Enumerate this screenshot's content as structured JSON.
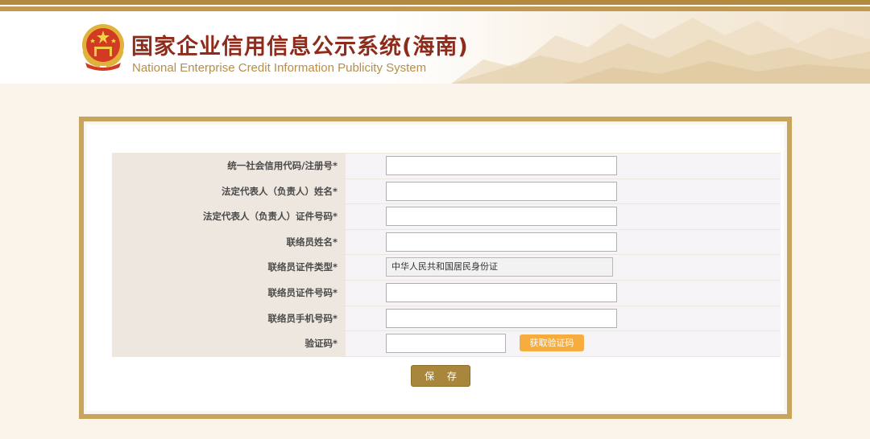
{
  "header": {
    "title_cn": "国家企业信用信息公示系统(海南)",
    "title_en": "National Enterprise Credit Information Publicity System",
    "emblem_icon": "national-emblem-icon"
  },
  "colors": {
    "accent_gold": "#c8a55c",
    "title_red": "#8e2b1b",
    "button_orange": "#f6ac3e",
    "button_brown": "#a8873d"
  },
  "form": {
    "fields": [
      {
        "label": "统一社会信用代码/注册号*",
        "value": ""
      },
      {
        "label": "法定代表人（负责人）姓名*",
        "value": ""
      },
      {
        "label": "法定代表人（负责人）证件号码*",
        "value": ""
      },
      {
        "label": "联络员姓名*",
        "value": ""
      },
      {
        "label": "联络员证件类型*",
        "value": "中华人民共和国居民身份证"
      },
      {
        "label": "联络员证件号码*",
        "value": ""
      },
      {
        "label": "联络员手机号码*",
        "value": ""
      },
      {
        "label": "验证码*",
        "value": ""
      }
    ],
    "get_code_label": "获取验证码",
    "save_label": "保 存"
  }
}
